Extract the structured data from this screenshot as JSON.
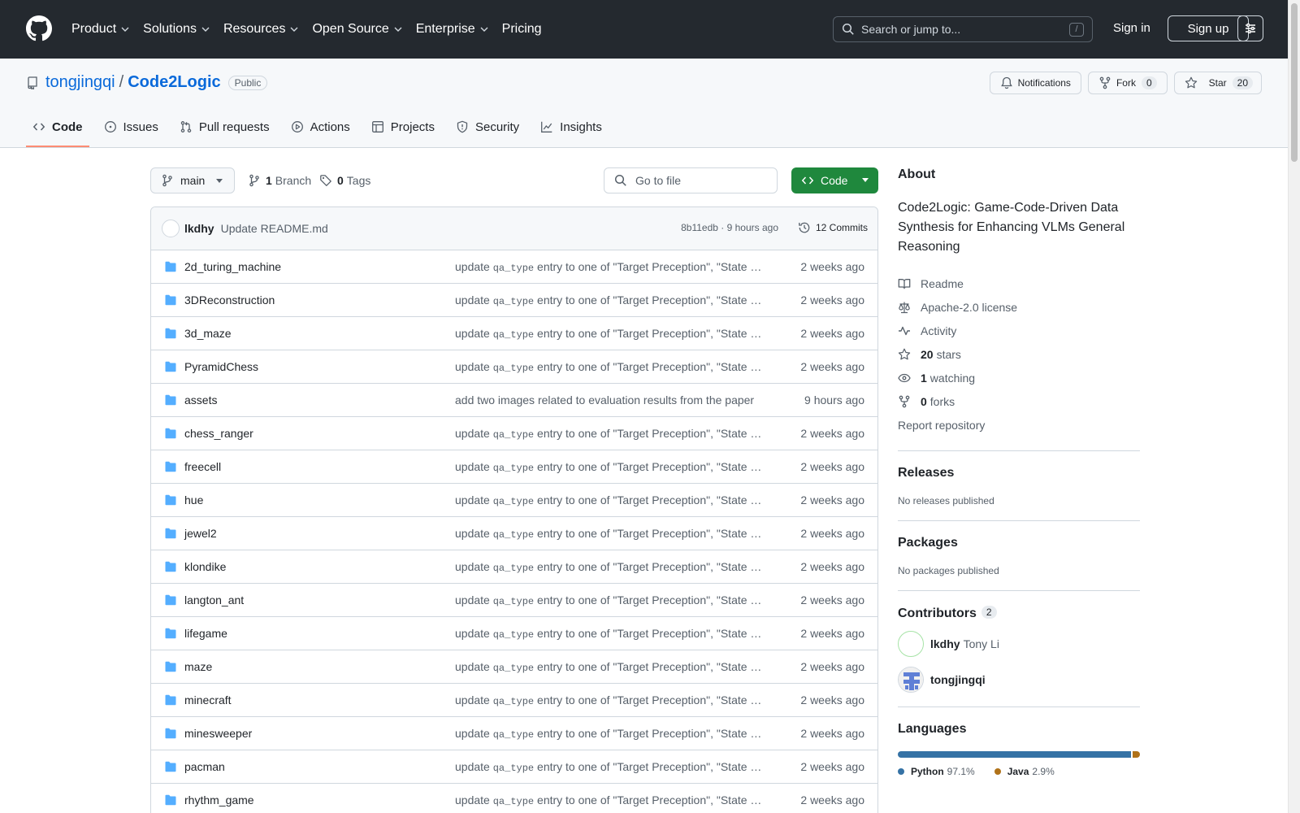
{
  "header": {
    "nav": [
      "Product",
      "Solutions",
      "Resources",
      "Open Source",
      "Enterprise",
      "Pricing"
    ],
    "search_placeholder": "Search or jump to...",
    "search_shortcut": "/",
    "signin": "Sign in",
    "signup": "Sign up"
  },
  "repo": {
    "owner": "tongjingqi",
    "separator": "/",
    "name": "Code2Logic",
    "visibility": "Public",
    "notifications_label": "Notifications",
    "fork_label": "Fork",
    "fork_count": "0",
    "star_label": "Star",
    "star_count": "20",
    "tabs": [
      "Code",
      "Issues",
      "Pull requests",
      "Actions",
      "Projects",
      "Security",
      "Insights"
    ]
  },
  "toolbar": {
    "branch": "main",
    "branch_count": "1",
    "branch_label": "Branch",
    "tag_count": "0",
    "tag_label": "Tags",
    "goto_placeholder": "Go to file",
    "code_label": "Code"
  },
  "commit": {
    "author": "lkdhy",
    "message": "Update README.md",
    "meta": "8b11edb · 9 hours ago",
    "commits_label": "12 Commits"
  },
  "files": [
    {
      "name": "2d_turing_machine",
      "pre": "update ",
      "code": "qa_type",
      "post": " entry to one of \"Target Preception\", \"State Prediction\"",
      "date": "2 weeks ago"
    },
    {
      "name": "3DReconstruction",
      "pre": "update ",
      "code": "qa_type",
      "post": " entry to one of \"Target Preception\", \"State Prediction\"",
      "date": "2 weeks ago"
    },
    {
      "name": "3d_maze",
      "pre": "update ",
      "code": "qa_type",
      "post": " entry to one of \"Target Preception\", \"State Prediction\"",
      "date": "2 weeks ago"
    },
    {
      "name": "PyramidChess",
      "pre": "update ",
      "code": "qa_type",
      "post": " entry to one of \"Target Preception\", \"State Prediction\"",
      "date": "2 weeks ago"
    },
    {
      "name": "assets",
      "pre": "add two images related to evaluation results from the paper",
      "code": "",
      "post": "",
      "date": "9 hours ago"
    },
    {
      "name": "chess_ranger",
      "pre": "update ",
      "code": "qa_type",
      "post": " entry to one of \"Target Preception\", \"State Prediction\"",
      "date": "2 weeks ago"
    },
    {
      "name": "freecell",
      "pre": "update ",
      "code": "qa_type",
      "post": " entry to one of \"Target Preception\", \"State Prediction\"",
      "date": "2 weeks ago"
    },
    {
      "name": "hue",
      "pre": "update ",
      "code": "qa_type",
      "post": " entry to one of \"Target Preception\", \"State Prediction\"",
      "date": "2 weeks ago"
    },
    {
      "name": "jewel2",
      "pre": "update ",
      "code": "qa_type",
      "post": " entry to one of \"Target Preception\", \"State Prediction\"",
      "date": "2 weeks ago"
    },
    {
      "name": "klondike",
      "pre": "update ",
      "code": "qa_type",
      "post": " entry to one of \"Target Preception\", \"State Prediction\"",
      "date": "2 weeks ago"
    },
    {
      "name": "langton_ant",
      "pre": "update ",
      "code": "qa_type",
      "post": " entry to one of \"Target Preception\", \"State Prediction\"",
      "date": "2 weeks ago"
    },
    {
      "name": "lifegame",
      "pre": "update ",
      "code": "qa_type",
      "post": " entry to one of \"Target Preception\", \"State Prediction\"",
      "date": "2 weeks ago"
    },
    {
      "name": "maze",
      "pre": "update ",
      "code": "qa_type",
      "post": " entry to one of \"Target Preception\", \"State Prediction\"",
      "date": "2 weeks ago"
    },
    {
      "name": "minecraft",
      "pre": "update ",
      "code": "qa_type",
      "post": " entry to one of \"Target Preception\", \"State Prediction\"",
      "date": "2 weeks ago"
    },
    {
      "name": "minesweeper",
      "pre": "update ",
      "code": "qa_type",
      "post": " entry to one of \"Target Preception\", \"State Prediction\"",
      "date": "2 weeks ago"
    },
    {
      "name": "pacman",
      "pre": "update ",
      "code": "qa_type",
      "post": " entry to one of \"Target Preception\", \"State Prediction\"",
      "date": "2 weeks ago"
    },
    {
      "name": "rhythm_game",
      "pre": "update ",
      "code": "qa_type",
      "post": " entry to one of \"Target Preception\", \"State Prediction\"",
      "date": "2 weeks ago"
    }
  ],
  "about": {
    "title": "About",
    "description": "Code2Logic: Game-Code-Driven Data Synthesis for Enhancing VLMs General Reasoning",
    "readme": "Readme",
    "license": "Apache-2.0 license",
    "activity": "Activity",
    "stars_count": "20",
    "stars_label": "stars",
    "watching_count": "1",
    "watching_label": "watching",
    "forks_count": "0",
    "forks_label": "forks",
    "report": "Report repository"
  },
  "releases": {
    "title": "Releases",
    "empty": "No releases published"
  },
  "packages": {
    "title": "Packages",
    "empty": "No packages published"
  },
  "contributors": {
    "title": "Contributors",
    "count": "2",
    "list": [
      {
        "login": "lkdhy",
        "name": "Tony Li"
      },
      {
        "login": "tongjingqi",
        "name": ""
      }
    ]
  },
  "languages": {
    "title": "Languages",
    "items": [
      {
        "name": "Python",
        "percent": 97.1,
        "label": "97.1%",
        "color": "#3572A5"
      },
      {
        "name": "Java",
        "percent": 2.9,
        "label": "2.9%",
        "color": "#b07219"
      }
    ]
  },
  "colors": {
    "header_bg": "#24292f",
    "accent_link": "#0969da",
    "code_button": "#1f883d",
    "tab_underline": "#fd8c73",
    "folder": "#54aeff"
  }
}
